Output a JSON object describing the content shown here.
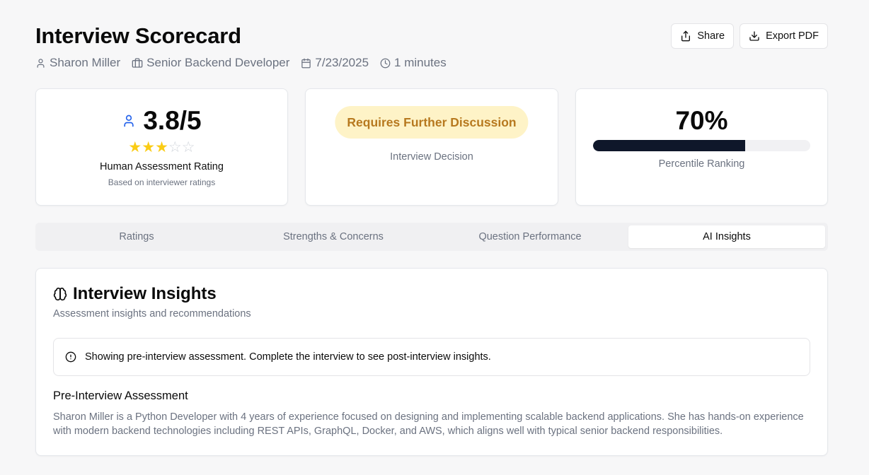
{
  "header": {
    "title": "Interview Scorecard",
    "candidate": "Sharon Miller",
    "role": "Senior Backend Developer",
    "date": "7/23/2025",
    "duration": "1 minutes"
  },
  "actions": {
    "share_label": "Share",
    "export_label": "Export PDF"
  },
  "rating_card": {
    "score": "3.8/5",
    "stars_filled": 3,
    "stars_total": 5,
    "label": "Human Assessment Rating",
    "sublabel": "Based on interviewer ratings"
  },
  "decision_card": {
    "decision": "Requires Further Discussion",
    "label": "Interview Decision"
  },
  "percentile_card": {
    "value": "70%",
    "fraction": 0.7,
    "label": "Percentile Ranking"
  },
  "tabs": [
    {
      "label": "Ratings",
      "active": false
    },
    {
      "label": "Strengths & Concerns",
      "active": false
    },
    {
      "label": "Question Performance",
      "active": false
    },
    {
      "label": "AI Insights",
      "active": true
    }
  ],
  "insights": {
    "title": "Interview Insights",
    "subtitle": "Assessment insights and recommendations",
    "alert": "Showing pre-interview assessment. Complete the interview to see post-interview insights.",
    "section_title": "Pre-Interview Assessment",
    "section_body": "Sharon Miller is a Python Developer with 4 years of experience focused on designing and implementing scalable backend applications. She has hands-on experience with modern backend technologies including REST APIs, GraphQL, Docker, and AWS, which aligns well with typical senior backend responsibilities."
  },
  "colors": {
    "star": "#facc15",
    "star_empty": "#d1d5db",
    "decision_bg": "#fef3c7",
    "decision_text": "#b7791f",
    "bar_fill": "#0f172a",
    "user_icon": "#2563eb"
  },
  "icons": [
    "user-icon",
    "briefcase-icon",
    "calendar-icon",
    "clock-icon",
    "share-icon",
    "download-icon",
    "brain-icon",
    "alert-circle-icon",
    "star-icon"
  ]
}
